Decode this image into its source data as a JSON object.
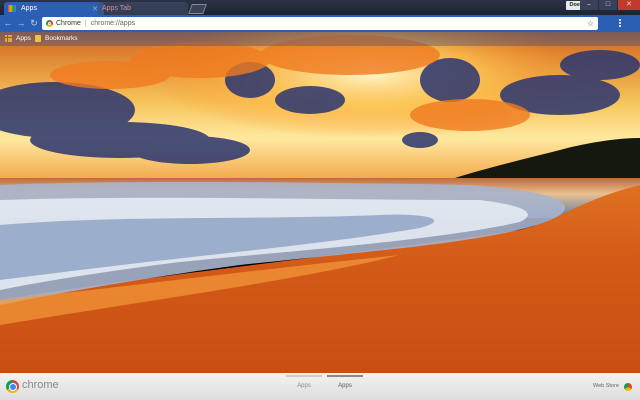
{
  "tabs": [
    {
      "label": "Apps"
    },
    {
      "label": "Apps Tab"
    }
  ],
  "user_badge": "DoeRay",
  "window_controls": [
    "–",
    "□",
    "✕"
  ],
  "omnibox": {
    "site_label": "Chrome",
    "url": "chrome://apps"
  },
  "bookmarks_bar": {
    "apps_label": "Apps",
    "bookmarks_label": "Bookmarks"
  },
  "footer": {
    "brand": "chrome",
    "pages": [
      {
        "label": "Apps",
        "active": false
      },
      {
        "label": "Apps",
        "active": true
      }
    ],
    "webstore_label": "Web Store"
  },
  "icons": {
    "back": "back-arrow-icon",
    "forward": "forward-arrow-icon",
    "reload": "reload-icon",
    "star": "star-icon",
    "menu": "menu-icon"
  },
  "colors": {
    "tabstrip": "#1f2433",
    "toolbar": "#2b5fb3",
    "sky_orange": "#f08a1c",
    "sand": "#d2561a"
  }
}
